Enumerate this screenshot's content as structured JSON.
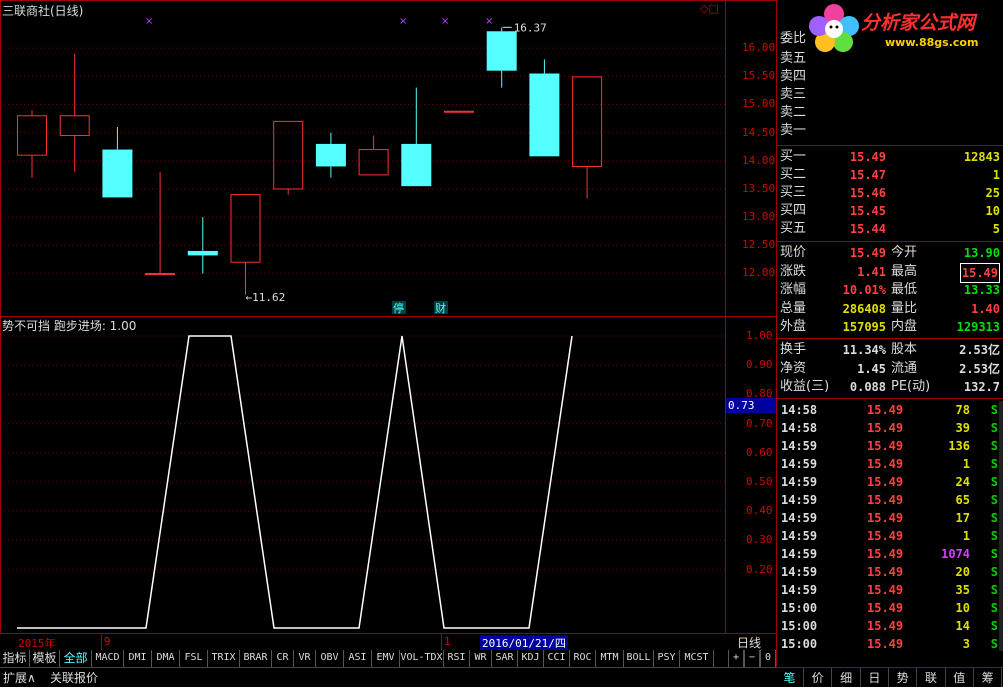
{
  "main_chart": {
    "title": "三联商社(日线)",
    "y_ticks": [
      "16.00",
      "15.50",
      "15.00",
      "14.50",
      "14.00",
      "13.50",
      "13.00",
      "12.50",
      "12.00"
    ],
    "high_label": "16.37",
    "low_label": "11.62",
    "markers": [
      "停",
      "财"
    ]
  },
  "indicator": {
    "title": "势不可挡 跑步进场: 1.00",
    "y_ticks": [
      "1.00",
      "0.90",
      "0.80",
      "0.70",
      "0.60",
      "0.50",
      "0.40",
      "0.30",
      "0.20"
    ],
    "current_value": "0.73"
  },
  "date_axis": {
    "year": "2015年",
    "month1": "9",
    "month2": "1",
    "cursor_date": "2016/01/21/四",
    "period": "日线"
  },
  "tabs": [
    "指标",
    "模板",
    "全部",
    "MACD",
    "DMI",
    "DMA",
    "FSL",
    "TRIX",
    "BRAR",
    "CR",
    "VR",
    "OBV",
    "ASI",
    "EMV",
    "VOL-TDX",
    "RSI",
    "WR",
    "SAR",
    "KDJ",
    "CCI",
    "ROC",
    "MTM",
    "BOLL",
    "PSY",
    "MCST"
  ],
  "zoom_controls": [
    "+",
    "−",
    "0"
  ],
  "bottom_buttons": [
    "扩展∧",
    "关联报价"
  ],
  "logo": {
    "text": "分析家公式网",
    "url": "www.88gs.com"
  },
  "order_book": {
    "header": "委比",
    "sells": [
      "卖五",
      "卖四",
      "卖三",
      "卖二",
      "卖一"
    ],
    "buys": [
      {
        "label": "买一",
        "price": "15.49",
        "vol": "12843"
      },
      {
        "label": "买二",
        "price": "15.47",
        "vol": "1"
      },
      {
        "label": "买三",
        "price": "15.46",
        "vol": "25"
      },
      {
        "label": "买四",
        "price": "15.45",
        "vol": "10"
      },
      {
        "label": "买五",
        "price": "15.44",
        "vol": "5"
      }
    ]
  },
  "quote": [
    {
      "l1": "现价",
      "v1": "15.49",
      "l2": "今开",
      "v2": "13.90",
      "c2": "#00e000"
    },
    {
      "l1": "涨跌",
      "v1": "1.41",
      "l2": "最高",
      "v2": "15.49",
      "c2": "#ff4040"
    },
    {
      "l1": "涨幅",
      "v1": "10.01%",
      "l2": "最低",
      "v2": "13.33",
      "c2": "#00e000"
    },
    {
      "l1": "总量",
      "v1": "286408",
      "l2": "量比",
      "v2": "1.40",
      "c2": "#ff4040"
    },
    {
      "l1": "外盘",
      "v1": "157095",
      "l2": "内盘",
      "v2": "129313",
      "c2": "#00e000"
    }
  ],
  "fundamentals": [
    {
      "l1": "换手",
      "v1": "11.34%",
      "l2": "股本",
      "v2": "2.53亿"
    },
    {
      "l1": "净资",
      "v1": "1.45",
      "l2": "流通",
      "v2": "2.53亿"
    },
    {
      "l1": "收益(三)",
      "v1": "0.088",
      "l2": "PE(动)",
      "v2": "132.7"
    }
  ],
  "ticks": [
    {
      "t": "14:58",
      "p": "15.49",
      "v": "78",
      "c": "#e0e000"
    },
    {
      "t": "14:58",
      "p": "15.49",
      "v": "39",
      "c": "#e0e000"
    },
    {
      "t": "14:59",
      "p": "15.49",
      "v": "136",
      "c": "#e0e000"
    },
    {
      "t": "14:59",
      "p": "15.49",
      "v": "1",
      "c": "#e0e000"
    },
    {
      "t": "14:59",
      "p": "15.49",
      "v": "24",
      "c": "#e0e000"
    },
    {
      "t": "14:59",
      "p": "15.49",
      "v": "65",
      "c": "#e0e000"
    },
    {
      "t": "14:59",
      "p": "15.49",
      "v": "17",
      "c": "#e0e000"
    },
    {
      "t": "14:59",
      "p": "15.49",
      "v": "1",
      "c": "#e0e000"
    },
    {
      "t": "14:59",
      "p": "15.49",
      "v": "1074",
      "c": "#d040ff"
    },
    {
      "t": "14:59",
      "p": "15.49",
      "v": "20",
      "c": "#e0e000"
    },
    {
      "t": "14:59",
      "p": "15.49",
      "v": "35",
      "c": "#e0e000"
    },
    {
      "t": "15:00",
      "p": "15.49",
      "v": "10",
      "c": "#e0e000"
    },
    {
      "t": "15:00",
      "p": "15.49",
      "v": "14",
      "c": "#e0e000"
    },
    {
      "t": "15:00",
      "p": "15.49",
      "v": "3",
      "c": "#e0e000"
    }
  ],
  "tick_side": "S",
  "side_tabs": [
    "笔",
    "价",
    "细",
    "日",
    "势",
    "联",
    "值",
    "筹"
  ],
  "chart_data": [
    {
      "type": "candlestick",
      "title": "三联商社(日线)",
      "ylim": [
        11.6,
        16.5
      ],
      "up_color": "#ff3030",
      "down_color": "#54ffff",
      "candles": [
        {
          "o": 14.1,
          "c": 14.8,
          "h": 14.9,
          "l": 13.7
        },
        {
          "o": 14.45,
          "c": 14.8,
          "h": 15.9,
          "l": 13.8
        },
        {
          "o": 14.2,
          "c": 13.35,
          "h": 14.6,
          "l": 13.35
        },
        {
          "o": 12.0,
          "c": 12.0,
          "h": 13.8,
          "l": 12.0
        },
        {
          "o": 12.4,
          "c": 12.32,
          "h": 13.0,
          "l": 12.0
        },
        {
          "o": 12.2,
          "c": 13.4,
          "h": 13.4,
          "l": 11.62
        },
        {
          "o": 13.5,
          "c": 14.7,
          "h": 14.7,
          "l": 13.4
        },
        {
          "o": 14.3,
          "c": 13.9,
          "h": 14.5,
          "l": 13.7
        },
        {
          "o": 13.75,
          "c": 14.2,
          "h": 14.45,
          "l": 13.75
        },
        {
          "o": 14.3,
          "c": 13.55,
          "h": 15.3,
          "l": 13.55
        },
        {
          "o": 14.88,
          "c": 14.88,
          "h": 14.88,
          "l": 14.88
        },
        {
          "o": 16.3,
          "c": 15.6,
          "h": 16.37,
          "l": 15.3
        },
        {
          "o": 15.55,
          "c": 14.08,
          "h": 15.8,
          "l": 14.08
        },
        {
          "o": 13.9,
          "c": 15.49,
          "h": 15.49,
          "l": 13.33
        }
      ]
    },
    {
      "type": "line",
      "title": "势不可挡 跑步进场: 1.00",
      "ylim": [
        0,
        1.05
      ],
      "color": "#ffffff",
      "x": [
        0,
        1,
        2,
        3,
        4,
        5,
        6,
        7,
        8,
        9,
        10,
        11,
        12,
        13,
        14
      ],
      "values": [
        0,
        0,
        0,
        0,
        1,
        1,
        0,
        0,
        0,
        1,
        0,
        0,
        0,
        1,
        1
      ],
      "x_start": [
        0,
        3
      ]
    }
  ]
}
